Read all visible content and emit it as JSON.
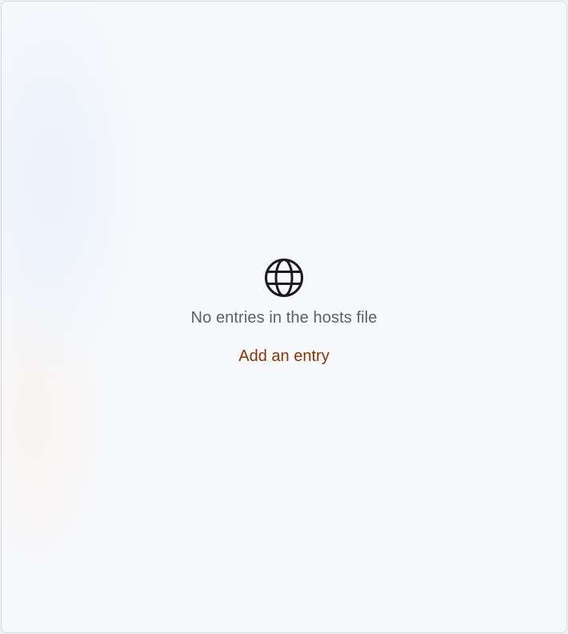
{
  "empty_state": {
    "icon": "globe-icon",
    "message": "No entries in the hosts file",
    "add_entry_label": "Add an entry"
  },
  "colors": {
    "background": "#f7f8fb",
    "message_text": "#5d5f63",
    "link_accent": "#8a3500",
    "icon": "#1b1b1b"
  }
}
